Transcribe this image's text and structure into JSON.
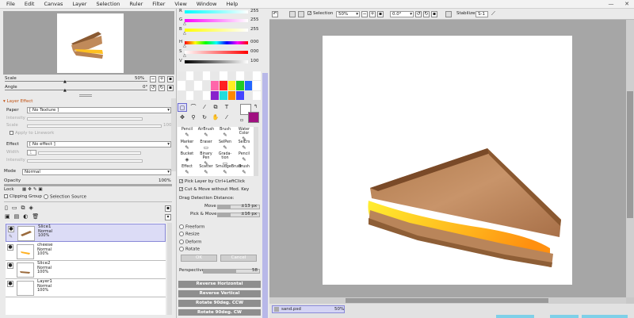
{
  "menu": [
    "File",
    "Edit",
    "Canvas",
    "Layer",
    "Selection",
    "Ruler",
    "Filter",
    "View",
    "Window",
    "Help"
  ],
  "window_controls": {
    "minimize": "—",
    "close": "✕"
  },
  "navigator": {
    "scale_label": "Scale",
    "scale_value": "50%",
    "angle_label": "Angle",
    "angle_value": "0°"
  },
  "layer_effect": {
    "header": "Layer Effect",
    "paper_label": "Paper",
    "paper_value": "[ No Texture ]",
    "intensity_label": "Intensity",
    "scale_label": "Scale",
    "scale_pct": "100%",
    "apply_label": "Apply to Linework",
    "effect_label": "Effect",
    "effect_value": "[ No effect ]",
    "width_label": "Width",
    "width_value": "1",
    "intensity2_label": "Intensity"
  },
  "layer_props": {
    "mode_label": "Mode",
    "mode_value": "Normal",
    "opacity_label": "Opacity",
    "opacity_value": "100%",
    "lock_label": "Lock",
    "clipping_label": "Clipping Group",
    "selection_source_label": "Selection Source"
  },
  "layers": [
    {
      "name": "Slice1",
      "mode": "Normal",
      "opacity": "100%",
      "selected": true
    },
    {
      "name": "cheese",
      "mode": "Normal",
      "opacity": "100%",
      "selected": false
    },
    {
      "name": "Slice2",
      "mode": "Normal",
      "opacity": "100%",
      "selected": false
    },
    {
      "name": "Layer1",
      "mode": "Normal",
      "opacity": "100%",
      "selected": false
    }
  ],
  "color": {
    "r_label": "R",
    "r_value": "255",
    "g_label": "G",
    "g_value": "255",
    "b_label": "B",
    "b_value": "255",
    "h_label": "H",
    "h_value": "000",
    "s_label": "S",
    "s_value": "000",
    "v_label": "V",
    "v_value": "100",
    "primary": "#ffffff",
    "secondary": "#a01080"
  },
  "swatches": [
    "#e8e8e8",
    "#ffffff",
    "#e8e8e8",
    "#ffffff",
    "#e8e8e8",
    "#ffffff",
    "#e8e8e8",
    "#ffffff",
    "#e8e8e8",
    "#ffffff",
    "#ffffff",
    "#e8e8e8",
    "#ffffff",
    "#e8e8e8",
    "#ff66aa",
    "#ff2222",
    "#ffee22",
    "#22cc22",
    "#2266ff",
    "#ffffff",
    "#e8e8e8",
    "#ffffff",
    "#e8e8e8",
    "#ffffff",
    "#8822cc",
    "#22dddd",
    "#ff8800",
    "#4444ff",
    "#e8e8e8",
    "#ffffff"
  ],
  "tools": {
    "selection": [
      {
        "name": "marquee-icon",
        "glyph": "▢"
      },
      {
        "name": "lasso-icon",
        "glyph": "⌒"
      },
      {
        "name": "magic-wand-icon",
        "glyph": "⁄"
      },
      {
        "name": "move-icon",
        "glyph": "⧉"
      },
      {
        "name": "text-tool-icon",
        "glyph": "T"
      }
    ],
    "view": [
      {
        "name": "move-arrows-icon",
        "glyph": "✥"
      },
      {
        "name": "zoom-icon",
        "glyph": "⚲"
      },
      {
        "name": "rotate-icon",
        "glyph": "↻"
      },
      {
        "name": "hand-icon",
        "glyph": "✋"
      },
      {
        "name": "eyedropper-icon",
        "glyph": "⁄"
      }
    ]
  },
  "brushes": [
    {
      "name": "Pencil",
      "glyph": "✎"
    },
    {
      "name": "AirBrush",
      "glyph": "✎"
    },
    {
      "name": "Brush",
      "glyph": "✎"
    },
    {
      "name": "Water Color",
      "glyph": "✎"
    },
    {
      "name": "Marker",
      "glyph": "✎"
    },
    {
      "name": "Eraser",
      "glyph": "▭"
    },
    {
      "name": "SelPen",
      "glyph": "✎"
    },
    {
      "name": "SelErs",
      "glyph": "✎"
    },
    {
      "name": "Bucket",
      "glyph": "◈"
    },
    {
      "name": "Binary Pen",
      "glyph": "✎"
    },
    {
      "name": "Grada- tion",
      "glyph": "▭"
    },
    {
      "name": "Pencil",
      "glyph": "✎"
    },
    {
      "name": "Effect",
      "glyph": "✎"
    },
    {
      "name": "Scatter",
      "glyph": "✎"
    },
    {
      "name": "SmudgeBrush",
      "glyph": "✎"
    },
    {
      "name": "Brush",
      "glyph": "✎"
    }
  ],
  "selection_opts": {
    "pick_layer": "Pick Layer by Ctrl+LeftClick",
    "cut_move": "Cut & Move without Mod. Key",
    "drag_label": "Drag Detection Distance:",
    "move_label": "Move",
    "move_value": "±13 px",
    "pick_move_label": "Pick & Move",
    "pick_move_value": "±16 px",
    "modes": [
      "Freeform",
      "Resize",
      "Deform",
      "Rotate"
    ],
    "ok": "OK",
    "cancel": "Cancel",
    "perspective_label": "Perspective",
    "perspective_value": "58",
    "actions": [
      "Reverse Horizontal",
      "Reverse Vertical",
      "Rotate 90deg. CCW",
      "Rotate 90deg. CW"
    ]
  },
  "toolbar": {
    "selection_label": "Selection",
    "zoom_value": "50%",
    "rotation_value": "0.0°",
    "stabilizer_label": "Stabilizer",
    "stabilizer_value": "S-1"
  },
  "status": {
    "filename": "sand.psd",
    "zoom": "50%"
  }
}
